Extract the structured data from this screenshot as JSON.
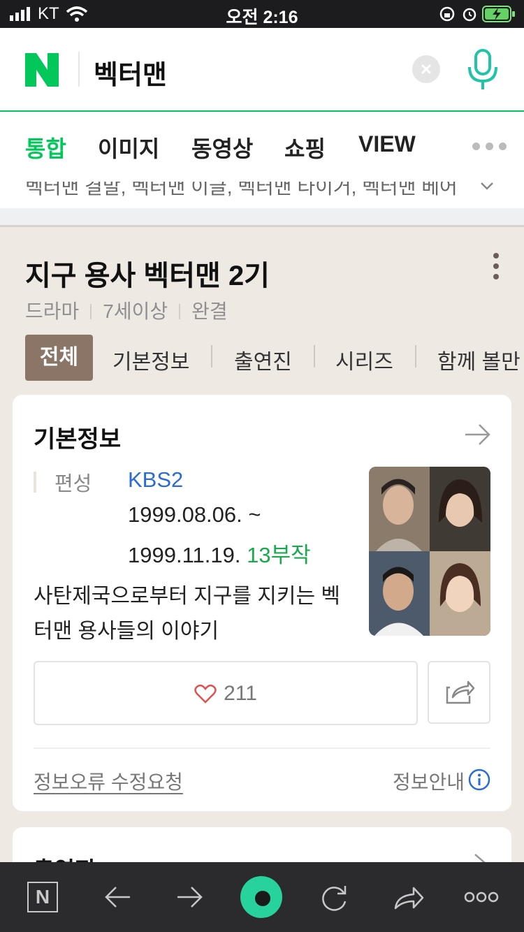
{
  "status_bar": {
    "carrier": "KT",
    "time": "오전 2:16"
  },
  "search": {
    "query": "벡터맨",
    "logo_letter": "N"
  },
  "tabs": [
    {
      "label": "통합",
      "active": true
    },
    {
      "label": "이미지",
      "active": false
    },
    {
      "label": "동영상",
      "active": false
    },
    {
      "label": "쇼핑",
      "active": false
    },
    {
      "label": "VIEW",
      "active": false
    }
  ],
  "peek_text": "벡터맨 결말, 벡터맨 이글, 벡터맨 타이거, 벡터맨 베어",
  "drama": {
    "title": "지구 용사 벡터맨 2기",
    "meta": [
      "드라마",
      "7세이상",
      "완결"
    ],
    "subtabs": [
      "전체",
      "기본정보",
      "출연진",
      "시리즈",
      "함께 볼만"
    ]
  },
  "basic_info": {
    "section_title": "기본정보",
    "field_label": "편성",
    "broadcaster": "KBS2",
    "date_start": "1999.08.06. ~",
    "date_end": "1999.11.19.",
    "episodes": "13부작",
    "description": "사탄제국으로부터 지구를 지키는 벡터맨 용사들의 이야기",
    "likes": "211",
    "error_link": "정보오류 수정요청",
    "info_label": "정보안내"
  },
  "next_section_title": "출연진",
  "colors": {
    "naver_green": "#03c75a",
    "tab_active_bg": "#8b7566",
    "link_blue": "#2a6bd6",
    "episodes_green": "#19a84b"
  }
}
